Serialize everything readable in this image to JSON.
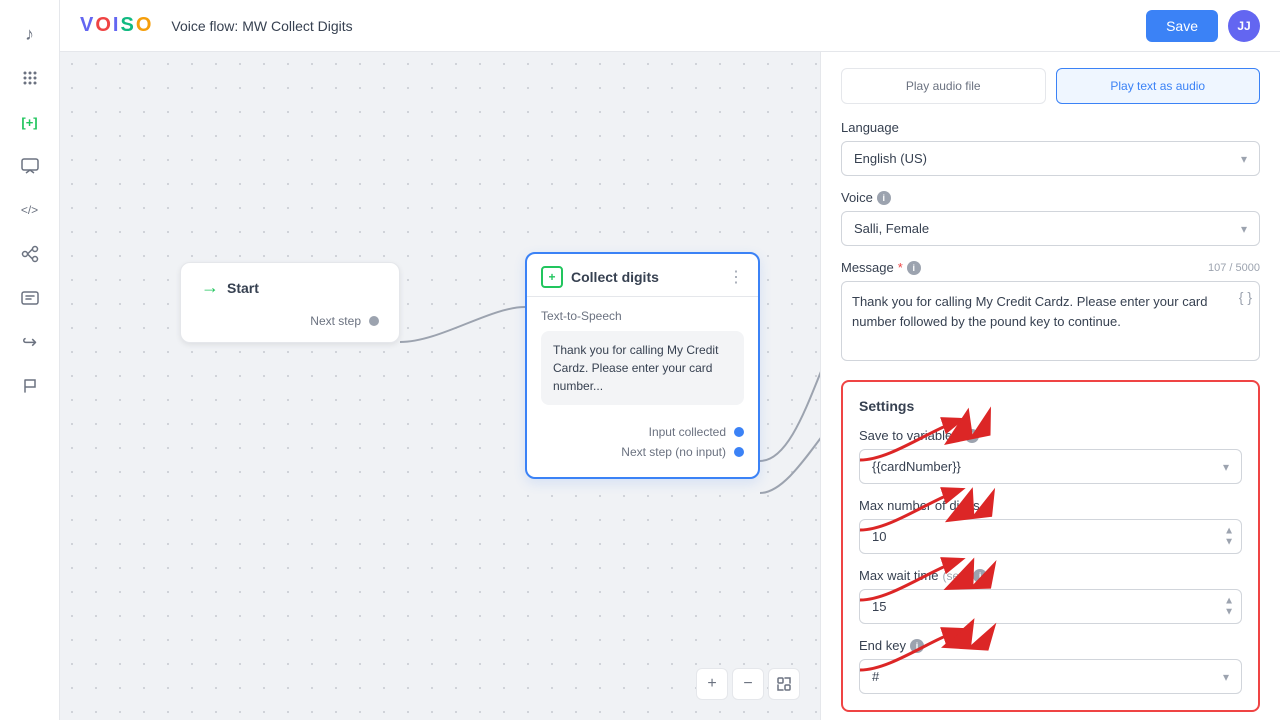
{
  "header": {
    "logo": {
      "v": "V",
      "o1": "O",
      "i": "I",
      "s": "S",
      "o2": "O"
    },
    "title": "Voice flow: MW Collect Digits",
    "save_label": "Save",
    "avatar_initials": "JJ"
  },
  "sidebar": {
    "icons": [
      {
        "name": "music-icon",
        "symbol": "♪"
      },
      {
        "name": "grid-icon",
        "symbol": "⠿"
      },
      {
        "name": "plus-icon",
        "symbol": "[+]"
      },
      {
        "name": "chat-icon",
        "symbol": "💬"
      },
      {
        "name": "code-icon",
        "symbol": "</>"
      },
      {
        "name": "branch-icon",
        "symbol": "⑂"
      },
      {
        "name": "message-icon",
        "symbol": "✉"
      },
      {
        "name": "forward-icon",
        "symbol": "↪"
      },
      {
        "name": "flag-icon",
        "symbol": "⚑"
      }
    ]
  },
  "canvas": {
    "start_node": {
      "label": "Start",
      "next_step_label": "Next step"
    },
    "collect_node": {
      "title": "Collect digits",
      "tts_label": "Text-to-Speech",
      "tts_text": "Thank you for calling My Credit Cardz. Please enter your card number...",
      "output1": "Input collected",
      "output2": "Next step (no input)"
    },
    "controls": {
      "plus": "+",
      "minus": "−",
      "fit": "⛶"
    }
  },
  "right_panel": {
    "audio_tab_audio_file": "Play audio file",
    "audio_tab_tts": "Play text as audio",
    "language_label": "Language",
    "language_value": "English (US)",
    "voice_label": "Voice",
    "voice_value": "Salli, Female",
    "message_label": "Message",
    "message_required": true,
    "message_counter": "107 / 5000",
    "message_value": "Thank you for calling My Credit Cardz. Please enter your card number followed by the pound key to continue.",
    "settings": {
      "title": "Settings",
      "save_to_variable_label": "Save to variable",
      "save_to_variable_required": true,
      "save_to_variable_value": "{{cardNumber}}",
      "max_digits_label": "Max number of digits",
      "max_digits_value": "10",
      "max_wait_label": "Max wait time",
      "max_wait_unit": "(sec)",
      "max_wait_value": "15",
      "end_key_label": "End key",
      "end_key_value": "#"
    }
  }
}
